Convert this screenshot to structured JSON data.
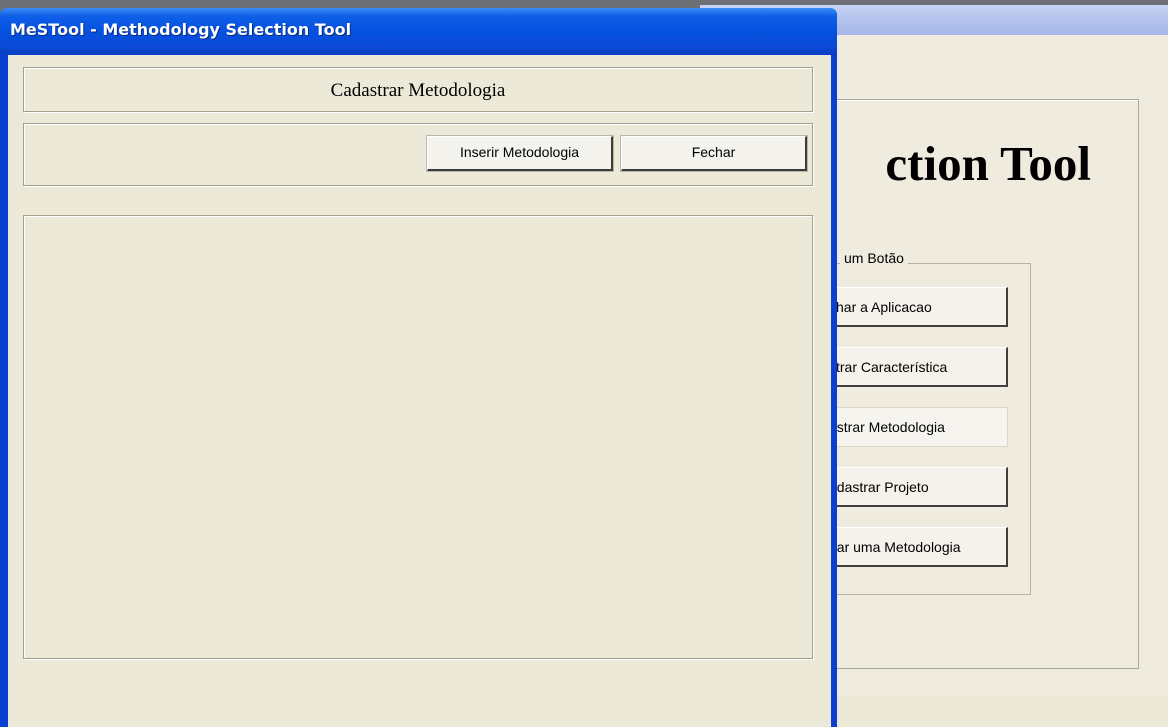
{
  "background_window": {
    "heading_fragment": "ction Tool",
    "group_legend": "um Botão",
    "buttons": [
      {
        "label": "char a Aplicacao"
      },
      {
        "label": "strar Característica"
      },
      {
        "label": "astrar Metodologia"
      },
      {
        "label": "adastrar Projeto"
      },
      {
        "label": "nar uma Metodologia"
      }
    ]
  },
  "dialog": {
    "title": "MeSTool - Methodology Selection Tool",
    "header": "Cadastrar Metodologia",
    "toolbar": {
      "insert_label": "Inserir Metodologia",
      "close_label": "Fechar"
    }
  },
  "colors": {
    "titlebar_blue": "#0551e0",
    "window_face": "#ece9d8",
    "desktop_gray": "#6e7076"
  }
}
